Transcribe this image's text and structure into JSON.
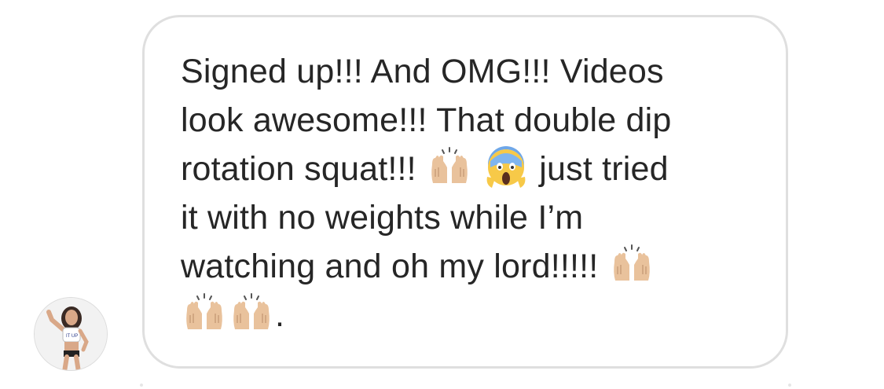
{
  "message": {
    "lines": [
      "Signed up!!! And OMG!!! Videos",
      "look awesome!!! That double dip",
      "rotation squat!!!",
      "just tried",
      "it with no weights while I’m",
      "watching and oh my lord!!!!!",
      "."
    ]
  },
  "emojis": {
    "raised_hands": "raised-hands-icon",
    "scream": "face-screaming-icon"
  },
  "colors": {
    "text": "#262626",
    "bubble_border": "#dfdfdf",
    "skin": "#e9c29c",
    "face": "#f7c948"
  }
}
